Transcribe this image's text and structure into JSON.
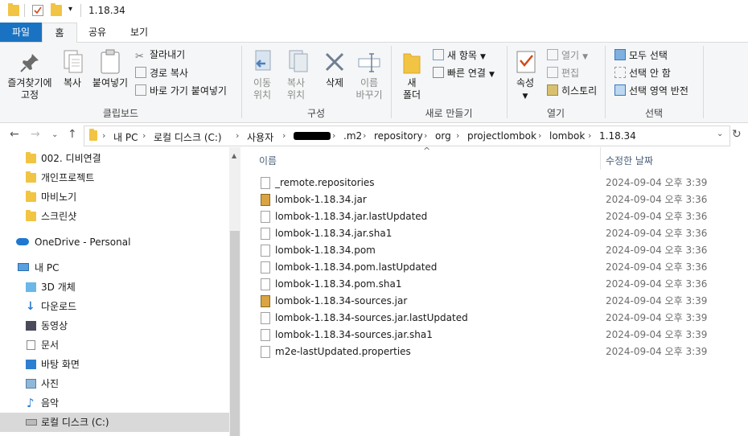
{
  "window": {
    "title": "1.18.34"
  },
  "tabs": {
    "file": "파일",
    "home": "홈",
    "share": "공유",
    "view": "보기"
  },
  "ribbon": {
    "clipboard": {
      "pin": "즐겨찾기에\n고정",
      "copy": "복사",
      "paste": "붙여넣기",
      "cut": "잘라내기",
      "copy_path": "경로 복사",
      "paste_shortcut": "바로 가기 붙여넣기",
      "label": "클립보드"
    },
    "organize": {
      "move_to": "이동\n위치",
      "copy_to": "복사\n위치",
      "delete": "삭제",
      "rename": "이름\n바꾸기",
      "label": "구성"
    },
    "new": {
      "new_folder": "새\n폴더",
      "new_item": "새 항목",
      "easy_access": "빠른 연결",
      "label": "새로 만들기"
    },
    "open": {
      "properties": "속성",
      "open": "열기",
      "edit": "편집",
      "history": "히스토리",
      "label": "열기"
    },
    "select": {
      "select_all": "모두 선택",
      "select_none": "선택 안 함",
      "invert": "선택 영역 반전",
      "label": "선택"
    }
  },
  "address": {
    "crumbs": [
      "내 PC",
      "로컬 디스크 (C:)",
      "사용자",
      "",
      ".m2",
      "repository",
      "org",
      "projectlombok",
      "lombok",
      "1.18.34"
    ]
  },
  "nav": {
    "items": [
      "002. 디비연결",
      "개인프로젝트",
      "마비노기",
      "스크린샷"
    ],
    "onedrive": "OneDrive - Personal",
    "thispc": "내 PC",
    "pc_items": [
      "3D 개체",
      "다운로드",
      "동영상",
      "문서",
      "바탕 화면",
      "사진",
      "음악",
      "로컬 디스크 (C:)"
    ]
  },
  "columns": {
    "name": "이름",
    "date": "수정한 날짜"
  },
  "files": [
    {
      "name": "_remote.repositories",
      "date": "2024-09-04 오후 3:39",
      "icon": "doc"
    },
    {
      "name": "lombok-1.18.34.jar",
      "date": "2024-09-04 오후 3:36",
      "icon": "jar"
    },
    {
      "name": "lombok-1.18.34.jar.lastUpdated",
      "date": "2024-09-04 오후 3:36",
      "icon": "doc"
    },
    {
      "name": "lombok-1.18.34.jar.sha1",
      "date": "2024-09-04 오후 3:36",
      "icon": "doc"
    },
    {
      "name": "lombok-1.18.34.pom",
      "date": "2024-09-04 오후 3:36",
      "icon": "doc"
    },
    {
      "name": "lombok-1.18.34.pom.lastUpdated",
      "date": "2024-09-04 오후 3:36",
      "icon": "doc"
    },
    {
      "name": "lombok-1.18.34.pom.sha1",
      "date": "2024-09-04 오후 3:36",
      "icon": "doc"
    },
    {
      "name": "lombok-1.18.34-sources.jar",
      "date": "2024-09-04 오후 3:39",
      "icon": "jar"
    },
    {
      "name": "lombok-1.18.34-sources.jar.lastUpdated",
      "date": "2024-09-04 오후 3:39",
      "icon": "doc"
    },
    {
      "name": "lombok-1.18.34-sources.jar.sha1",
      "date": "2024-09-04 오후 3:39",
      "icon": "doc"
    },
    {
      "name": "m2e-lastUpdated.properties",
      "date": "2024-09-04 오후 3:39",
      "icon": "doc"
    }
  ]
}
